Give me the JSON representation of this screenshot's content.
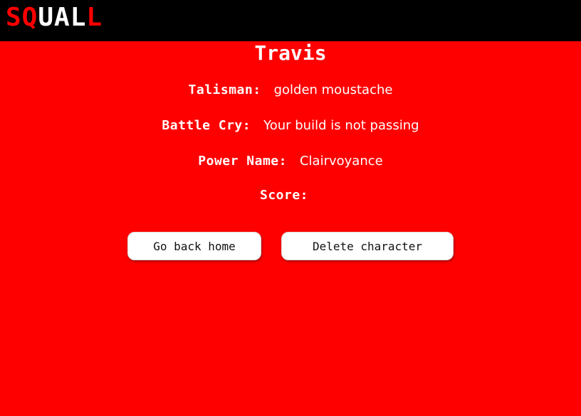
{
  "header": {
    "logo": {
      "part1": "SQ",
      "part2": "UAL",
      "part3": "L"
    }
  },
  "character": {
    "name": "Travis",
    "fields": [
      {
        "label": "Talisman:",
        "value": "golden moustache"
      },
      {
        "label": "Battle Cry:",
        "value": "Your build is not passing"
      },
      {
        "label": "Power Name:",
        "value": "Clairvoyance"
      },
      {
        "label": "Score:",
        "value": ""
      }
    ]
  },
  "actions": {
    "home_label": "Go back home",
    "delete_label": "Delete character"
  },
  "colors": {
    "background": "#fe0000",
    "header": "#000000",
    "text": "#ffffff"
  }
}
